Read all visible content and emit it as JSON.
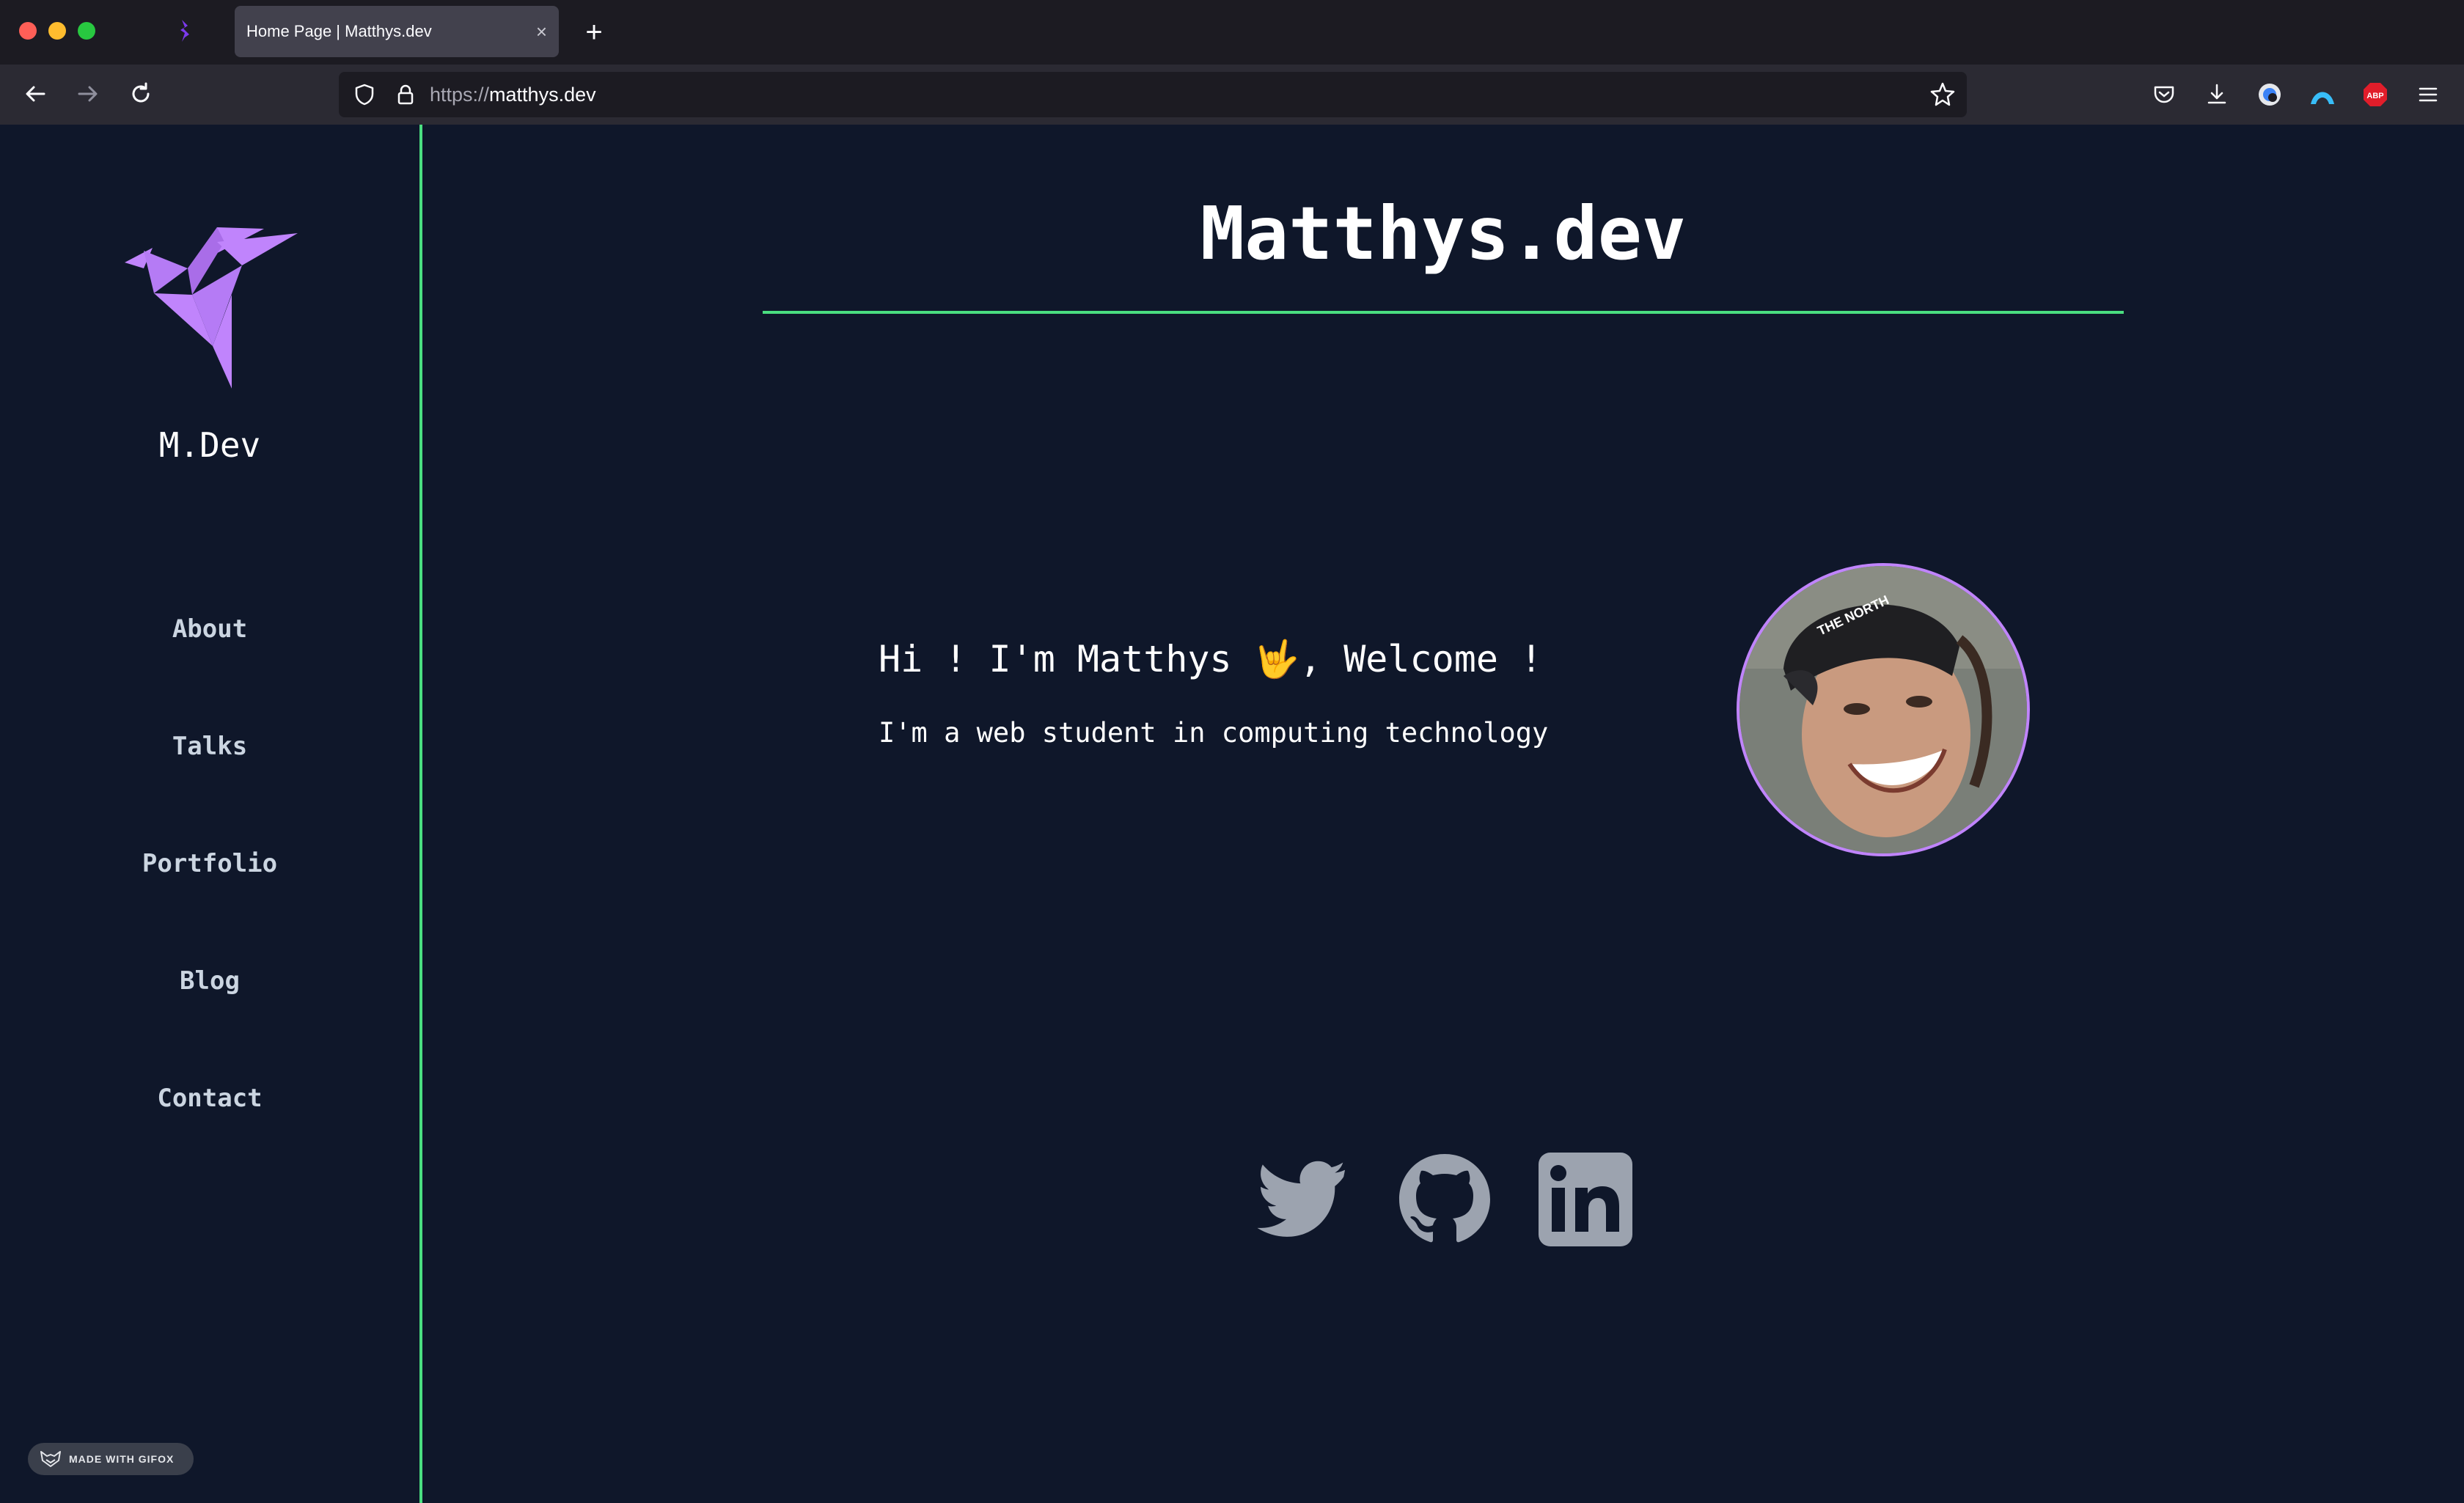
{
  "browser": {
    "tab_title": "Home Page | Matthys.dev",
    "tab_close": "×",
    "new_tab": "+",
    "url_protocol": "https://",
    "url_host": "matthys.dev"
  },
  "sidebar": {
    "brand": "M.Dev",
    "nav": [
      {
        "label": "About"
      },
      {
        "label": "Talks"
      },
      {
        "label": "Portfolio"
      },
      {
        "label": "Blog"
      },
      {
        "label": "Contact"
      }
    ],
    "badge": "MADE WITH GIFOX"
  },
  "main": {
    "title": "Matthys.dev",
    "greeting": "Hi ! I'm Matthys 🤟, Welcome !",
    "subtitle": "I'm a web student in computing technology"
  },
  "colors": {
    "background": "#0f172a",
    "accent_green": "#4ade80",
    "accent_purple": "#c084fc",
    "icon_gray": "#9ca3af"
  },
  "icons": [
    "shield-icon",
    "lock-icon",
    "star-icon",
    "pocket-icon",
    "download-icon",
    "extension-icon",
    "vpn-icon",
    "adblock-icon",
    "menu-icon",
    "twitter-icon",
    "github-icon",
    "linkedin-icon",
    "origami-bird-logo"
  ]
}
